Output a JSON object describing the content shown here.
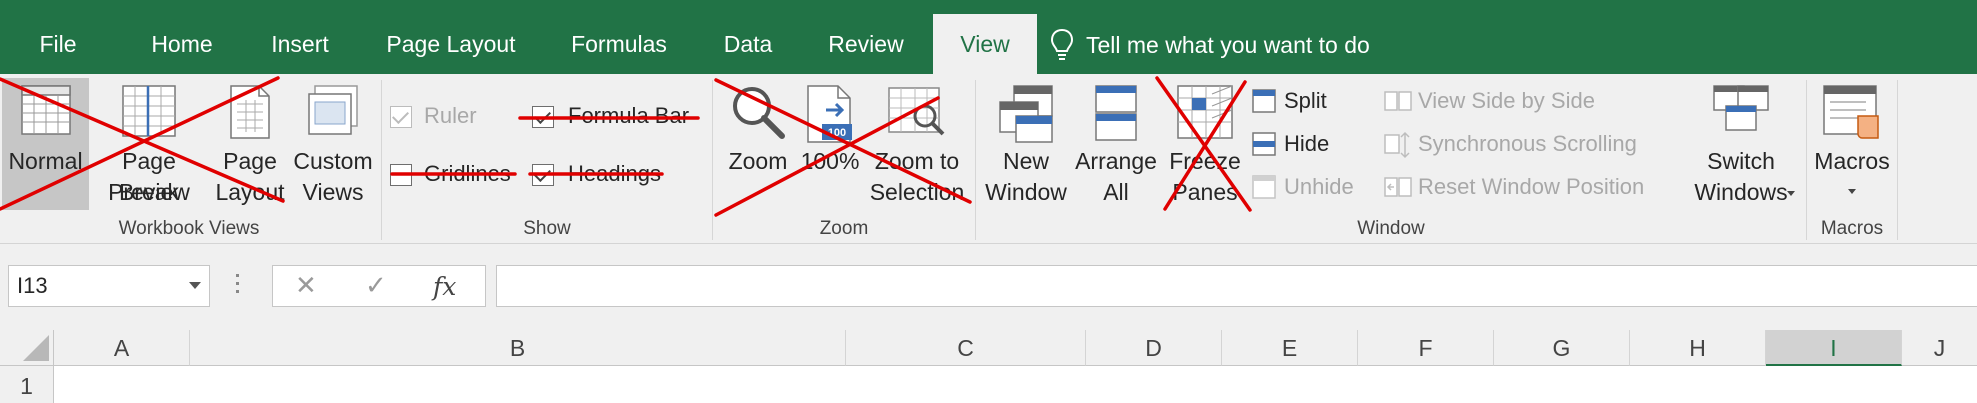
{
  "tabs": [
    {
      "label": "File"
    },
    {
      "label": "Home"
    },
    {
      "label": "Insert"
    },
    {
      "label": "Page Layout"
    },
    {
      "label": "Formulas"
    },
    {
      "label": "Data"
    },
    {
      "label": "Review"
    },
    {
      "label": "View",
      "active": true
    }
  ],
  "tell_me": "Tell me what you want to do",
  "ribbon": {
    "workbook_views": {
      "label": "Workbook Views",
      "normal": "Normal",
      "page_break_1": "Page Break",
      "page_break_2": "Preview",
      "page_layout_1": "Page",
      "page_layout_2": "Layout",
      "custom_1": "Custom",
      "custom_2": "Views"
    },
    "show": {
      "label": "Show",
      "ruler": "Ruler",
      "formula_bar": "Formula Bar",
      "gridlines": "Gridlines",
      "headings": "Headings"
    },
    "zoom": {
      "label": "Zoom",
      "zoom": "Zoom",
      "hundred": "100%",
      "badge": "100",
      "zoom_sel_1": "Zoom to",
      "zoom_sel_2": "Selection"
    },
    "window": {
      "label": "Window",
      "new_1": "New",
      "new_2": "Window",
      "arrange_1": "Arrange",
      "arrange_2": "All",
      "freeze_1": "Freeze",
      "freeze_2": "Panes",
      "split": "Split",
      "hide": "Hide",
      "unhide": "Unhide",
      "side_by_side": "View Side by Side",
      "sync_scroll": "Synchronous Scrolling",
      "reset_pos": "Reset Window Position",
      "switch_1": "Switch",
      "switch_2": "Windows"
    },
    "macros": {
      "label": "Macros",
      "macros": "Macros"
    }
  },
  "formula_bar": {
    "name_box": "I13",
    "cancel": "✕",
    "enter": "✓",
    "fx": "fx",
    "value": ""
  },
  "columns": [
    "A",
    "B",
    "C",
    "D",
    "E",
    "F",
    "G",
    "H",
    "I",
    "J"
  ],
  "selected_column": "I",
  "rows": [
    "1"
  ],
  "colors": {
    "accent": "#217346",
    "strike": "#e00000",
    "ribbon_bg": "#f0f0f0"
  }
}
